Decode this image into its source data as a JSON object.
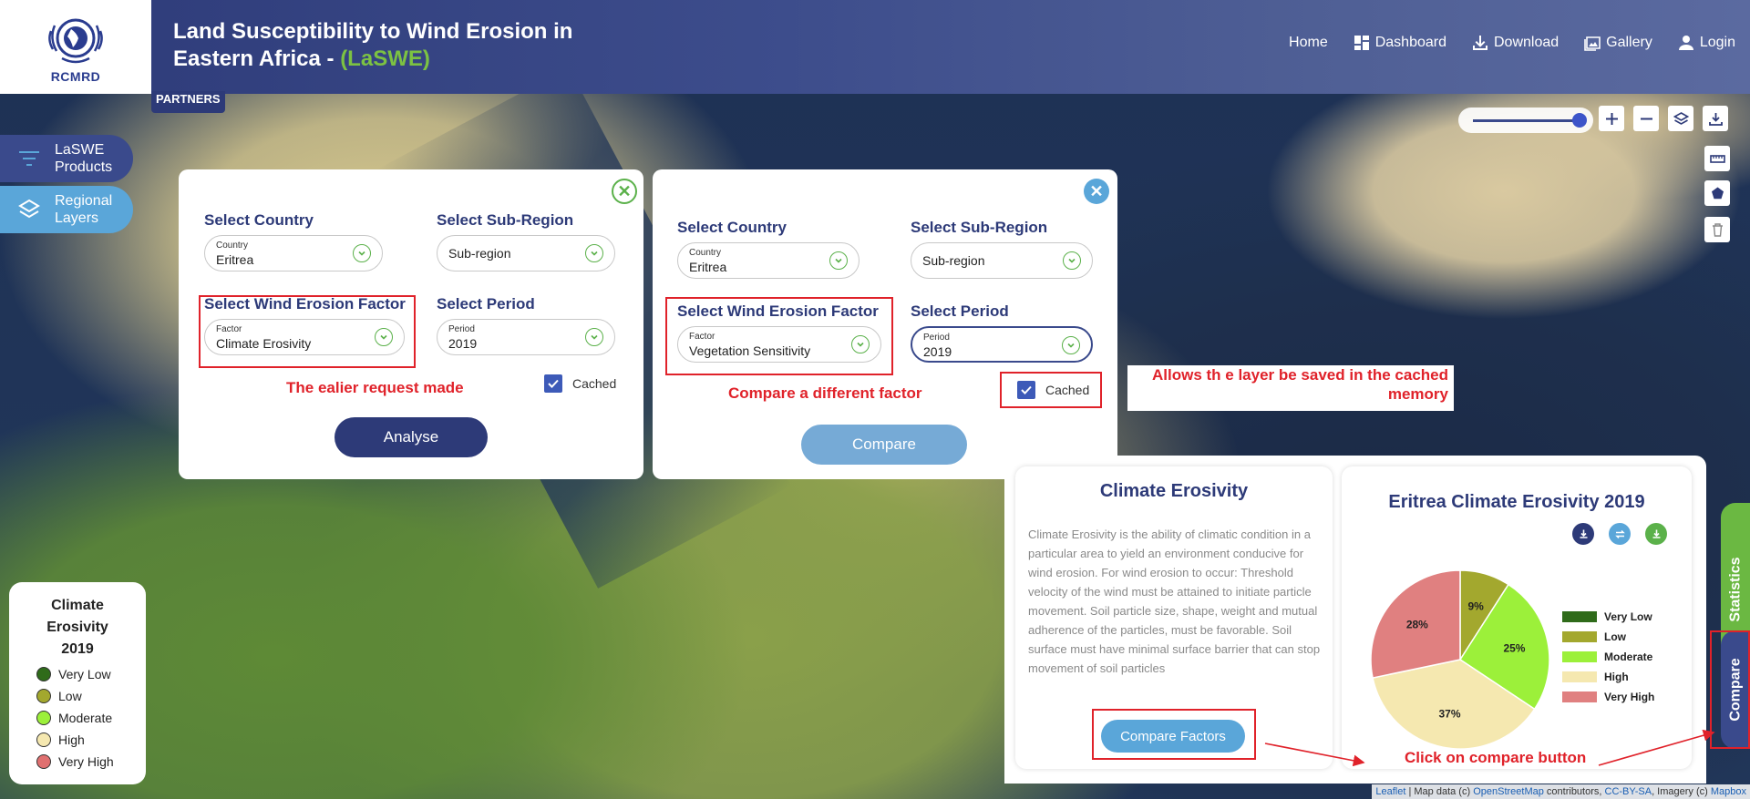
{
  "header": {
    "logo_text": "RCMRD",
    "title_main": "Land Susceptibility to Wind Erosion in Eastern Africa - ",
    "title_accent": "(LaSWE)",
    "partners": "PARTNERS",
    "nav": [
      {
        "label": "Home",
        "icon": ""
      },
      {
        "label": "Dashboard",
        "icon": "dashboard-icon"
      },
      {
        "label": "Download",
        "icon": "download-icon"
      },
      {
        "label": "Gallery",
        "icon": "gallery-icon"
      },
      {
        "label": "Login",
        "icon": "user-icon"
      }
    ]
  },
  "sidebar": {
    "products": "LaSWE Products",
    "layers": "Regional Layers"
  },
  "left_panel": {
    "country_label": "Select Country",
    "country_small": "Country",
    "country_value": "Eritrea",
    "subregion_label": "Select Sub-Region",
    "subregion_value": "Sub-region",
    "factor_label": "Select Wind Erosion Factor",
    "factor_small": "Factor",
    "factor_value": "Climate Erosivity",
    "period_label": "Select Period",
    "period_small": "Period",
    "period_value": "2019",
    "cached_label": "Cached",
    "cached_checked": true,
    "annotation": "The ealier request made",
    "button": "Analyse"
  },
  "right_panel": {
    "country_label": "Select Country",
    "country_small": "Country",
    "country_value": "Eritrea",
    "subregion_label": "Select Sub-Region",
    "subregion_value": "Sub-region",
    "factor_label": "Select Wind Erosion Factor",
    "factor_small": "Factor",
    "factor_value": "Vegetation Sensitivity",
    "period_label": "Select Period",
    "period_small": "Period",
    "period_value": "2019",
    "cached_label": "Cached",
    "cached_checked": true,
    "annotation": "Compare a different factor",
    "button": "Compare"
  },
  "annotations": {
    "cached_line1": "Allows th e layer be saved in the cached",
    "cached_line2": "memory",
    "click_compare": "Click on compare button"
  },
  "description_card": {
    "title": "Climate Erosivity",
    "text": "Climate Erosivity is the ability of climatic condition in a particular area to yield an environment conducive for wind erosion. For wind erosion to occur: Threshold velocity of the wind must be attained to initiate particle movement. Soil particle size, shape, weight and mutual adherence of the particles, must be favorable. Soil surface must have minimal surface barrier that can stop movement of soil particles",
    "button": "Compare Factors"
  },
  "chart_card": {
    "title": "Eritrea Climate Erosivity 2019",
    "icons": [
      "download-icon",
      "swap-icon",
      "export-icon"
    ]
  },
  "chart_data": {
    "type": "pie",
    "title": "Eritrea Climate Erosivity 2019",
    "categories": [
      "Very Low",
      "Low",
      "Moderate",
      "High",
      "Very High"
    ],
    "values": [
      0,
      9,
      25,
      37,
      28
    ],
    "value_labels": [
      "",
      "9%",
      "25%",
      "37%",
      "28%"
    ],
    "colors": [
      "#2f6b1a",
      "#a3a82e",
      "#9cf03a",
      "#f5e8b0",
      "#e08080"
    ],
    "legend_position": "right"
  },
  "tabs": {
    "statistics": "Statistics",
    "compare": "Compare"
  },
  "map_legend": {
    "title_line1": "Climate",
    "title_line2": "Erosivity",
    "title_line3": "2019",
    "items": [
      {
        "label": "Very Low",
        "color": "#2f6b1a"
      },
      {
        "label": "Low",
        "color": "#a3a82e"
      },
      {
        "label": "Moderate",
        "color": "#9cf03a"
      },
      {
        "label": "High",
        "color": "#f5e8b0"
      },
      {
        "label": "Very High",
        "color": "#e07070"
      }
    ]
  },
  "attribution": {
    "leaflet": "Leaflet",
    "map_data": " | Map data (c) ",
    "osm": "OpenStreetMap",
    "contributors": " contributors, ",
    "license": "CC-BY-SA",
    "imagery": ", Imagery (c) ",
    "mapbox": "Mapbox"
  }
}
